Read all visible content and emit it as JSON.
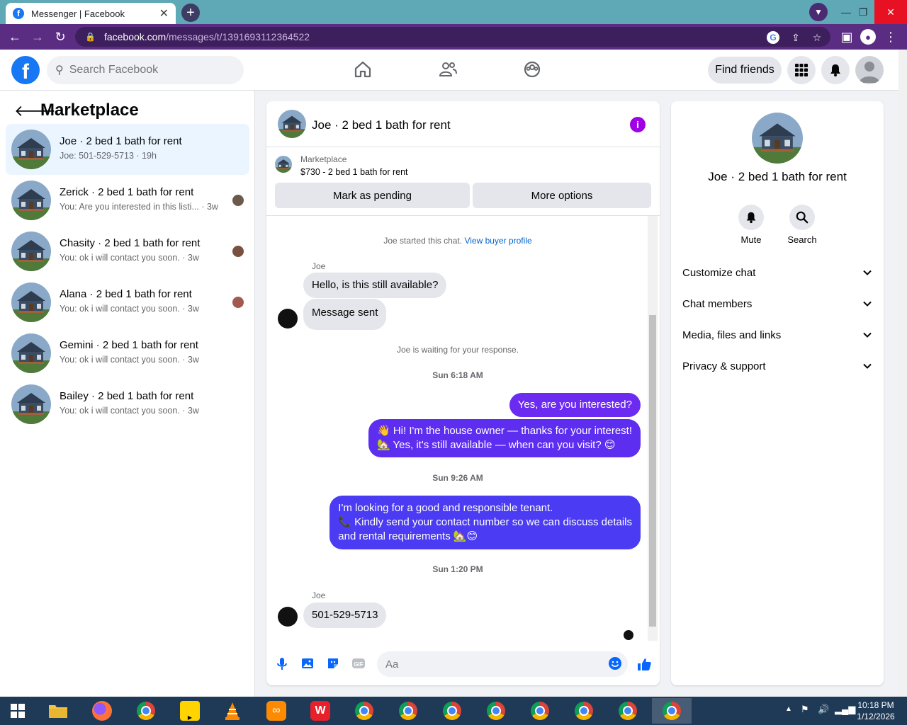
{
  "browser": {
    "tab_title": "Messenger | Facebook",
    "url_host": "facebook.com",
    "url_path": "/messages/t/1391693112364522"
  },
  "header": {
    "search_placeholder": "Search Facebook",
    "find_friends": "Find friends"
  },
  "left": {
    "title": "Marketplace",
    "conversations": [
      {
        "name": "Joe · 2 bed 1 bath for rent",
        "sub": "Joe: 501-529-5713 · 19h"
      },
      {
        "name": "Zerick · 2 bed 1 bath for rent",
        "sub": "You: Are you interested in this listi... · 3w"
      },
      {
        "name": "Chasity · 2 bed 1 bath for rent",
        "sub": "You: ok i will contact you soon. · 3w"
      },
      {
        "name": "Alana · 2 bed 1 bath for rent",
        "sub": "You: ok i will contact you soon. · 3w"
      },
      {
        "name": "Gemini · 2 bed 1 bath for rent",
        "sub": "You: ok i will contact you soon. · 3w"
      },
      {
        "name": "Bailey · 2 bed 1 bath for rent",
        "sub": "You: ok i will contact you soon. · 3w"
      }
    ]
  },
  "chat": {
    "title": "Joe · 2 bed 1 bath for rent",
    "marketplace_label": "Marketplace",
    "listing": "$730 - 2 bed 1 bath for rent",
    "mark_pending": "Mark as pending",
    "more_options": "More options",
    "started": "Joe started this chat.",
    "view_profile": "View buyer profile",
    "sender": "Joe",
    "msg1": "Hello, is this still available?",
    "msg2": "Message sent",
    "waiting": "Joe is waiting for your response.",
    "stamp1": "Sun 6:18 AM",
    "out1": "Yes, are you interested?",
    "out2_line1": "👋 Hi! I'm the house owner — thanks for your interest!",
    "out2_line2": "🏡 Yes, it's still available — when can you visit? 😊",
    "stamp2": "Sun 9:26 AM",
    "out3_line1": "I'm looking for a good and responsible tenant.",
    "out3_line2": "📞 Kindly send your contact number so we can discuss details",
    "out3_line3": "and rental requirements 🏡😊",
    "stamp3": "Sun 1:20 PM",
    "sender2": "Joe",
    "msg3": "501-529-5713",
    "input_placeholder": "Aa"
  },
  "right": {
    "name": "Joe · 2 bed 1 bath for rent",
    "mute": "Mute",
    "search": "Search",
    "sections": [
      "Customize chat",
      "Chat members",
      "Media, files and links",
      "Privacy & support"
    ]
  },
  "taskbar": {
    "time": "10:18 PM",
    "date": "1/12/2026"
  },
  "colors": {
    "fb_blue": "#1877f2",
    "outgoing_bubble": "#6b2bf0",
    "active_row": "#ebf5ff",
    "info_purple": "#a000e6"
  }
}
